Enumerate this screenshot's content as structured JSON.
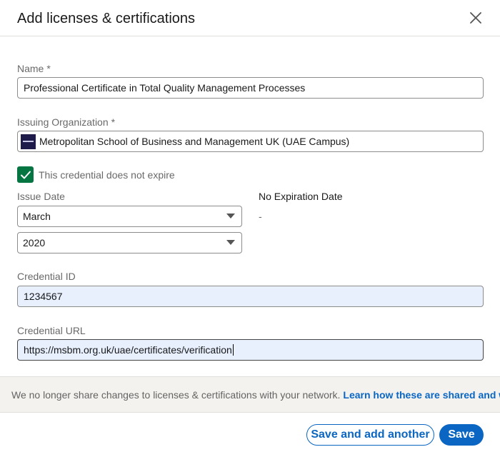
{
  "dialog": {
    "title": "Add licenses & certifications"
  },
  "form": {
    "name": {
      "label": "Name",
      "required_mark": "*",
      "value": "Professional Certificate in Total Quality Management Processes"
    },
    "organization": {
      "label": "Issuing Organization",
      "required_mark": "*",
      "value": "Metropolitan School of Business and Management UK (UAE Campus)"
    },
    "no_expire": {
      "label": "This credential does not expire",
      "checked": true
    },
    "issue_date": {
      "label": "Issue Date",
      "month": "March",
      "year": "2020"
    },
    "expiration": {
      "label": "No Expiration Date",
      "value": "-"
    },
    "credential_id": {
      "label": "Credential ID",
      "value": "1234567"
    },
    "credential_url": {
      "label": "Credential URL",
      "value": "https://msbm.org.uk/uae/certificates/verification"
    }
  },
  "notice": {
    "text": "We no longer share changes to licenses & certifications with your network.",
    "link": "Learn how these are shared and when"
  },
  "footer": {
    "secondary_label": "Save and add another",
    "primary_label": "Save"
  },
  "colors": {
    "primary": "#0a66c2",
    "checkbox": "#057642",
    "autofill": "#e8f0fe",
    "notice_bg": "#f3f2ef"
  },
  "icons": {
    "close": "close-icon",
    "check": "checkmark-icon",
    "dropdown": "caret-down-icon"
  }
}
